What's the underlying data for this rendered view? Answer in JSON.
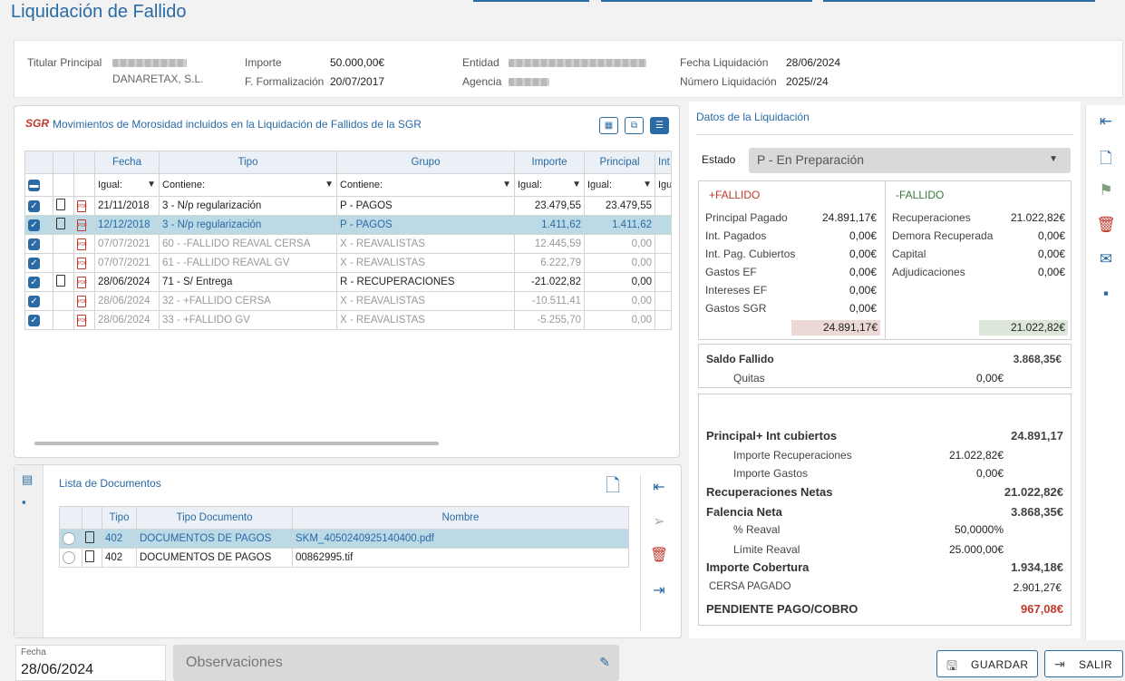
{
  "page_title": "Liquidación de Fallido",
  "header": {
    "titular_label": "Titular Principal",
    "importe_label": "Importe",
    "importe_value": "50.000,00€",
    "f_formalizacion_label": "F. Formalización",
    "f_formalizacion_value": "20/07/2017",
    "entidad_label": "Entidad",
    "agencia_label": "Agencia",
    "fecha_liq_label": "Fecha Liquidación",
    "fecha_liq_value": "28/06/2024",
    "num_liq_label": "Número Liquidación",
    "num_liq_value": "2025//24",
    "titular_partial": "DANARETAX, S.L."
  },
  "movimientos": {
    "logo_text": "SGR",
    "title": "Movimientos de Morosidad incluidos en la Liquidación de Fallidos de la SGR",
    "columns": [
      "Fecha",
      "Tipo",
      "Grupo",
      "Importe",
      "Principal",
      "Int"
    ],
    "filters": [
      "Igual:",
      "Contiene:",
      "Contiene:",
      "Igual:",
      "Igual:",
      "Igu"
    ],
    "rows": [
      {
        "fecha": "21/11/2018",
        "tipo": "3 - N/p regularización",
        "grupo": "P - PAGOS",
        "importe": "23.479,55",
        "principal": "23.479,55",
        "doc": true,
        "state": "normal"
      },
      {
        "fecha": "12/12/2018",
        "tipo": "3 - N/p regularización",
        "grupo": "P - PAGOS",
        "importe": "1.411,62",
        "principal": "1.411,62",
        "doc": true,
        "state": "sel"
      },
      {
        "fecha": "07/07/2021",
        "tipo": "60 - -FALLIDO REAVAL CERSA",
        "grupo": "X - REAVALISTAS",
        "importe": "12.445,59",
        "principal": "0,00",
        "doc": false,
        "state": "dim"
      },
      {
        "fecha": "07/07/2021",
        "tipo": "61 - -FALLIDO REAVAL GV",
        "grupo": "X - REAVALISTAS",
        "importe": "6.222,79",
        "principal": "0,00",
        "doc": false,
        "state": "dim"
      },
      {
        "fecha": "28/06/2024",
        "tipo": "71 - S/ Entrega",
        "grupo": "R - RECUPERACIONES",
        "importe": "-21.022,82",
        "principal": "0,00",
        "doc": true,
        "state": "normal"
      },
      {
        "fecha": "28/06/2024",
        "tipo": "32 - +FALLIDO CERSA",
        "grupo": "X - REAVALISTAS",
        "importe": "-10.511,41",
        "principal": "0,00",
        "doc": false,
        "state": "dim"
      },
      {
        "fecha": "28/06/2024",
        "tipo": "33 - +FALLIDO GV",
        "grupo": "X - REAVALISTAS",
        "importe": "-5.255,70",
        "principal": "0,00",
        "doc": false,
        "state": "dim"
      }
    ]
  },
  "documentos": {
    "title": "Lista de Documentos",
    "columns": [
      "Tipo",
      "Tipo Documento",
      "Nombre"
    ],
    "rows": [
      {
        "tipo": "402",
        "tipo_doc": "DOCUMENTOS DE PAGOS",
        "nombre": "SKM_4050240925140400.pdf",
        "state": "sel"
      },
      {
        "tipo": "402",
        "tipo_doc": "DOCUMENTOS DE PAGOS",
        "nombre": "00862995.tif",
        "state": "normal"
      }
    ]
  },
  "liquidacion": {
    "title": "Datos de la Liquidación",
    "estado_label": "Estado",
    "estado_value": "P - En Preparación",
    "mas_fallido": {
      "title": "+FALLIDO",
      "rows": [
        {
          "label": "Principal Pagado",
          "value": "24.891,17€"
        },
        {
          "label": "Int. Pagados",
          "value": "0,00€"
        },
        {
          "label": "Int. Pag. Cubiertos",
          "value": "0,00€"
        },
        {
          "label": "Gastos EF",
          "value": "0,00€"
        },
        {
          "label": "Intereses EF",
          "value": "0,00€"
        },
        {
          "label": "Gastos SGR",
          "value": "0,00€"
        }
      ],
      "total": "24.891,17€"
    },
    "menos_fallido": {
      "title": "-FALLIDO",
      "rows": [
        {
          "label": "Recuperaciones",
          "value": "21.022,82€"
        },
        {
          "label": "Demora Recuperada",
          "value": "0,00€"
        },
        {
          "label": "Capital",
          "value": "0,00€"
        },
        {
          "label": "Adjudicaciones",
          "value": "0,00€"
        }
      ],
      "total": "21.022,82€"
    },
    "saldo_label": "Saldo Fallido",
    "saldo_value": "3.868,35€",
    "quitas_label": "Quitas",
    "quitas_value": "0,00€",
    "resumen": [
      {
        "label": "Principal+ Int cubiertos",
        "value": "24.891,17",
        "style": "bold"
      },
      {
        "label": "Importe Recuperaciones",
        "value": "21.022,82€",
        "style": "indent"
      },
      {
        "label": "Importe Gastos",
        "value": "0,00€",
        "style": "indent"
      },
      {
        "label": "Recuperaciones Netas",
        "value": "21.022,82€",
        "style": "bold"
      },
      {
        "label": "Falencia Neta",
        "value": "3.868,35€",
        "style": "bold"
      },
      {
        "label": "% Reaval",
        "value": "50,0000%",
        "style": "indent"
      },
      {
        "label": "Límite Reaval",
        "value": "25.000,00€",
        "style": "indent"
      },
      {
        "label": "Importe Cobertura",
        "value": "1.934,18€",
        "style": "bold"
      },
      {
        "label": "CERSA PAGADO",
        "value": "2.901,27€",
        "style": "small"
      },
      {
        "label": "PENDIENTE PAGO/COBRO",
        "value": "967,08€",
        "style": "red"
      }
    ]
  },
  "footer": {
    "fecha_label": "Fecha",
    "fecha_value": "28/06/2024",
    "observaciones_placeholder": "Observaciones",
    "guardar_label": "GUARDAR",
    "salir_label": "SALIR"
  },
  "colors": {
    "accent": "#2a6aa5",
    "selected_row": "#bcd9e6",
    "mas_total_bg": "#ecd9d6",
    "menos_total_bg": "#dce6d9",
    "danger": "#c0392b"
  }
}
